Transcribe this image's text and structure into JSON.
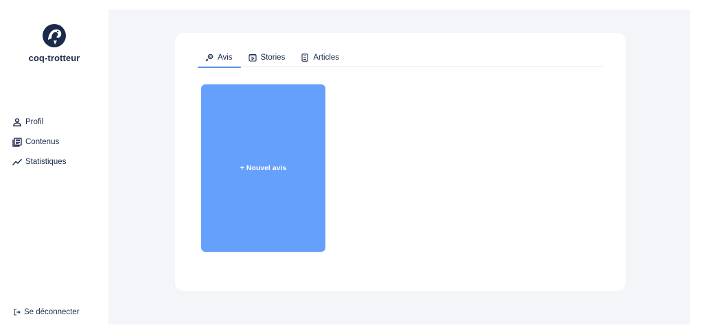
{
  "brand": {
    "name": "coq-trotteur",
    "logo_icon": "rooster-logo-icon"
  },
  "sidebar": {
    "items": [
      {
        "label": "Profil",
        "icon": "user-icon"
      },
      {
        "label": "Contenus",
        "icon": "content-icon"
      },
      {
        "label": "Statistiques",
        "icon": "chart-line-icon"
      }
    ],
    "logout_label": "Se déconnecter"
  },
  "tabs": [
    {
      "label": "Avis",
      "icon": "review-icon",
      "active": true
    },
    {
      "label": "Stories",
      "icon": "play-icon",
      "active": false
    },
    {
      "label": "Articles",
      "icon": "document-icon",
      "active": false
    }
  ],
  "content": {
    "new_item_label": "+ Nouvel avis"
  },
  "colors": {
    "accent": "#5b8ff0",
    "card_blue": "#66a0fd",
    "text": "#1b2a4a",
    "background": "#f4f5f9"
  }
}
